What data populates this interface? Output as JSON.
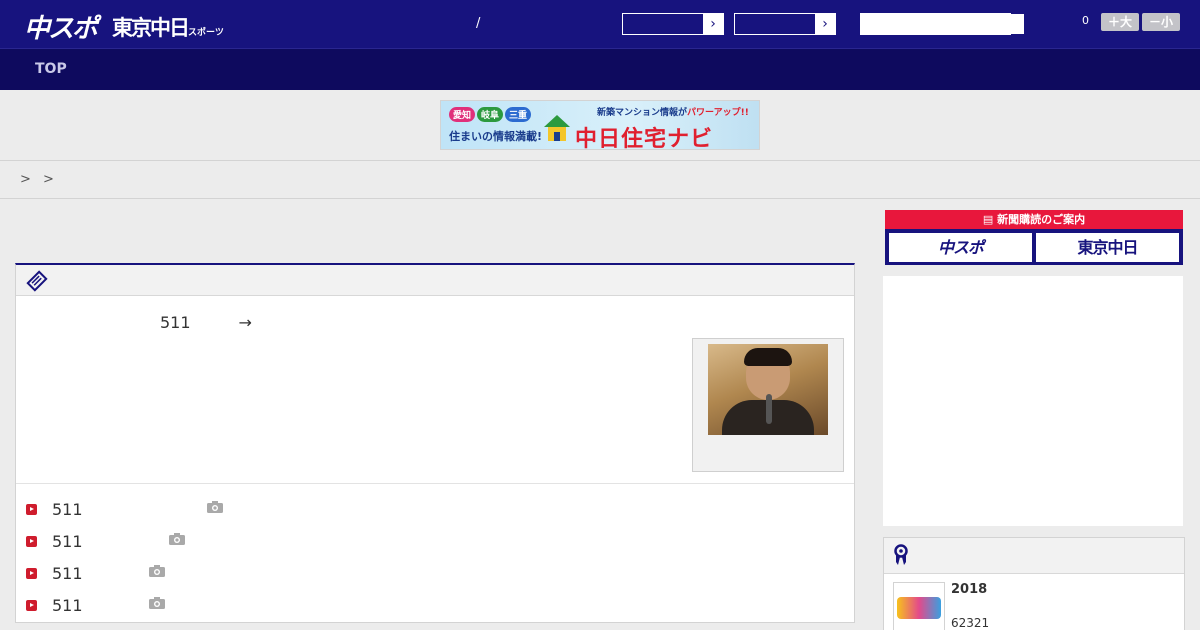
{
  "header": {
    "logo_chuspo": "中スポ",
    "logo_tokyo": "東京中日",
    "logo_tokyo_sub": "スポーツ",
    "slash": "/",
    "font_count": "0",
    "font_larger": "＋大",
    "font_smaller": "－小",
    "select_arrow": "›"
  },
  "nav": {
    "top": "TOP"
  },
  "banner": {
    "pref_aichi": "愛知",
    "pref_gifu": "岐阜",
    "pref_mie": "三重",
    "tagline": "住まいの情報満載!",
    "headline_prefix": "新築マンション情報が",
    "headline_accent": "パワーアップ!!",
    "brand": "中日住宅ナビ"
  },
  "breadcrumb": "> >",
  "article": {
    "lead": "511　　　→",
    "related": [
      {
        "text": "511"
      },
      {
        "text": "511"
      },
      {
        "text": "511"
      },
      {
        "text": "511"
      }
    ]
  },
  "subscription": {
    "heading": "新聞購読のご案内",
    "chuspo": "中スポ",
    "tokyo": "東京中日"
  },
  "ranking": {
    "year": "2018",
    "count": "62321"
  },
  "colors": {
    "header_bg": "#17137e",
    "nav_bg": "#0e0a5e",
    "accent_red": "#e8173c",
    "bullet_red": "#cf1c2d"
  }
}
